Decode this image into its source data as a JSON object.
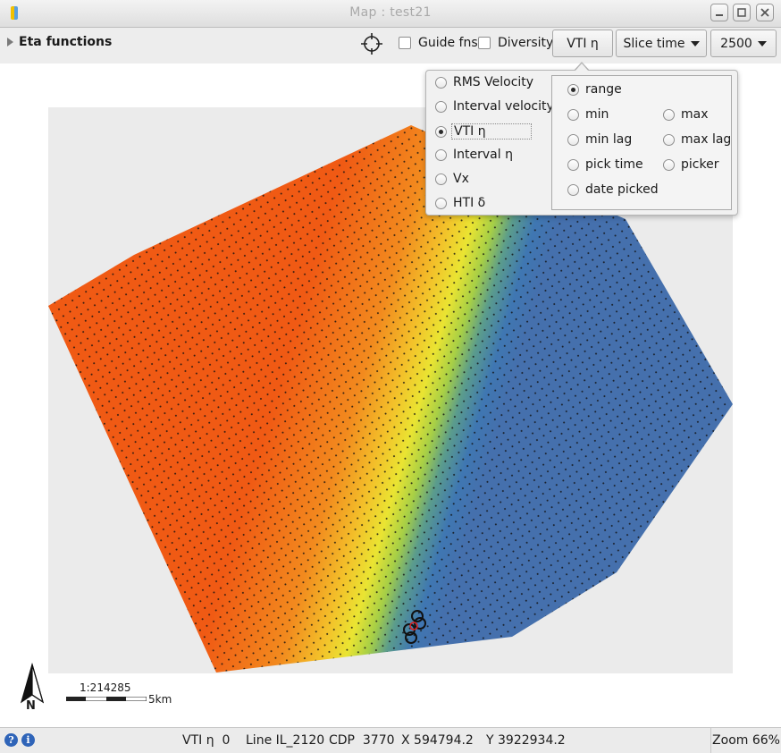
{
  "window": {
    "title": "Map : test21"
  },
  "toolbar": {
    "eta_label": "Eta functions",
    "guide_label": "Guide fns",
    "diversity_label": "Diversity",
    "function_button": "VTI η",
    "slice_button": "Slice time",
    "value_button": "2500"
  },
  "popup": {
    "functions": [
      {
        "label": "RMS Velocity",
        "selected": false
      },
      {
        "label": "Interval velocity",
        "selected": false
      },
      {
        "label": "VTI η",
        "selected": true
      },
      {
        "label": "Interval η",
        "selected": false
      },
      {
        "label": "Vx",
        "selected": false
      },
      {
        "label": "HTI δ",
        "selected": false
      }
    ],
    "modes": {
      "range": "range",
      "min": "min",
      "max": "max",
      "min_lag": "min lag",
      "max_lag": "max lag",
      "pick_time": "pick time",
      "picker": "picker",
      "date_picked": "date picked"
    },
    "selected_mode": "range"
  },
  "map": {
    "scale_ratio": "1:214285",
    "scale_distance": "5km",
    "north_label": "N"
  },
  "status": {
    "value": "VTI η  0",
    "line": "Line IL_2120",
    "cdp": "CDP  3770",
    "x": "X 594794.2",
    "y": "Y 3922934.2",
    "zoom": "Zoom 66%"
  },
  "colors": {
    "orange": "#f05a14",
    "yellow": "#eae432",
    "blue": "#3f77b2",
    "background": "#ebebeb"
  }
}
